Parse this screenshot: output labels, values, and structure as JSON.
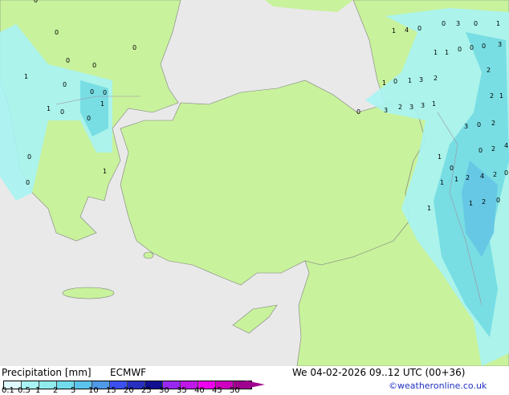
{
  "colors": {
    "land": "#c8f29c",
    "sea": "#e9e9e9",
    "border": "#a090a0",
    "coast": "#808080"
  },
  "map_labels": [
    "0",
    "0",
    "0",
    "0",
    "0",
    "1",
    "0",
    "0",
    "0",
    "1",
    "0",
    "1",
    "0",
    "0",
    "0",
    "1",
    "1",
    "4",
    "0",
    "0",
    "3",
    "0",
    "1",
    "1",
    "1",
    "0",
    "0",
    "0",
    "3",
    "2",
    "1",
    "0",
    "1",
    "3",
    "2",
    "2",
    "1",
    "3",
    "2",
    "3",
    "3",
    "1",
    "0",
    "3",
    "0",
    "2",
    "1",
    "0",
    "2",
    "4",
    "0",
    "1",
    "1",
    "2",
    "4",
    "2",
    "0",
    "1",
    "2",
    "0",
    "1"
  ],
  "legend": {
    "title": "Precipitation [mm]",
    "model": "ECMWF",
    "colors": [
      "#e0fbfb",
      "#a8f4f4",
      "#90ecec",
      "#70dcec",
      "#5cc4ec",
      "#5098e8",
      "#3c50f0",
      "#2830c0",
      "#101090",
      "#9828f0",
      "#c018e8",
      "#f000f0",
      "#d000c0",
      "#a00090"
    ],
    "ticks": [
      "0.1",
      "0.5",
      "1",
      "2",
      "5",
      "10",
      "15",
      "20",
      "25",
      "30",
      "35",
      "40",
      "45",
      "50"
    ]
  },
  "datetime": "We 04-02-2026 09..12 UTC (00+36)",
  "credit": "©weatheronline.co.uk"
}
